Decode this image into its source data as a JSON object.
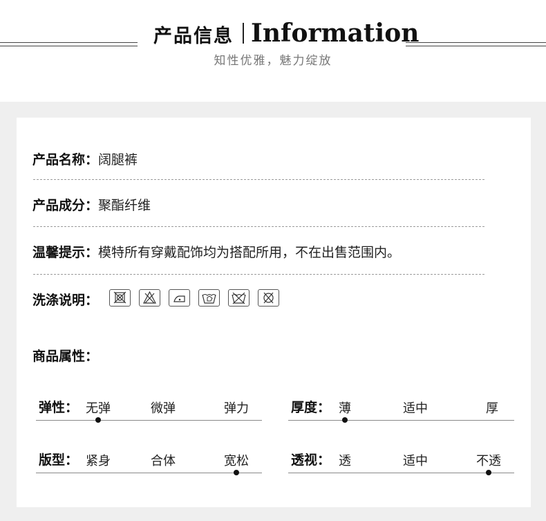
{
  "header": {
    "title_cn": "产品信息",
    "title_en": "Information",
    "subtitle": "知性优雅，魅力绽放"
  },
  "info": [
    {
      "label": "产品名称：",
      "value": "阔腿裤"
    },
    {
      "label": "产品成分：",
      "value": "聚酯纤维"
    },
    {
      "label": "温馨提示：",
      "value": "模特所有穿戴配饰均为搭配所用，不在出售范围内。"
    }
  ],
  "wash": {
    "label": "洗涤说明：",
    "icons": [
      "no-tumble-dry-icon",
      "do-not-bleach-icon",
      "low-iron-icon",
      "hand-wash-icon",
      "do-not-wash-icon",
      "do-not-dry-clean-icon"
    ]
  },
  "attributes": {
    "title": "商品属性：",
    "scales": [
      {
        "label": "弹性：",
        "options": [
          "无弹",
          "微弹",
          "弹力"
        ],
        "selected": 0
      },
      {
        "label": "厚度：",
        "options": [
          "薄",
          "适中",
          "厚"
        ],
        "selected": 0
      },
      {
        "label": "版型：",
        "options": [
          "紧身",
          "合体",
          "宽松"
        ],
        "selected": 2
      },
      {
        "label": "透视：",
        "options": [
          "透",
          "适中",
          "不透"
        ],
        "selected": 2
      }
    ]
  }
}
